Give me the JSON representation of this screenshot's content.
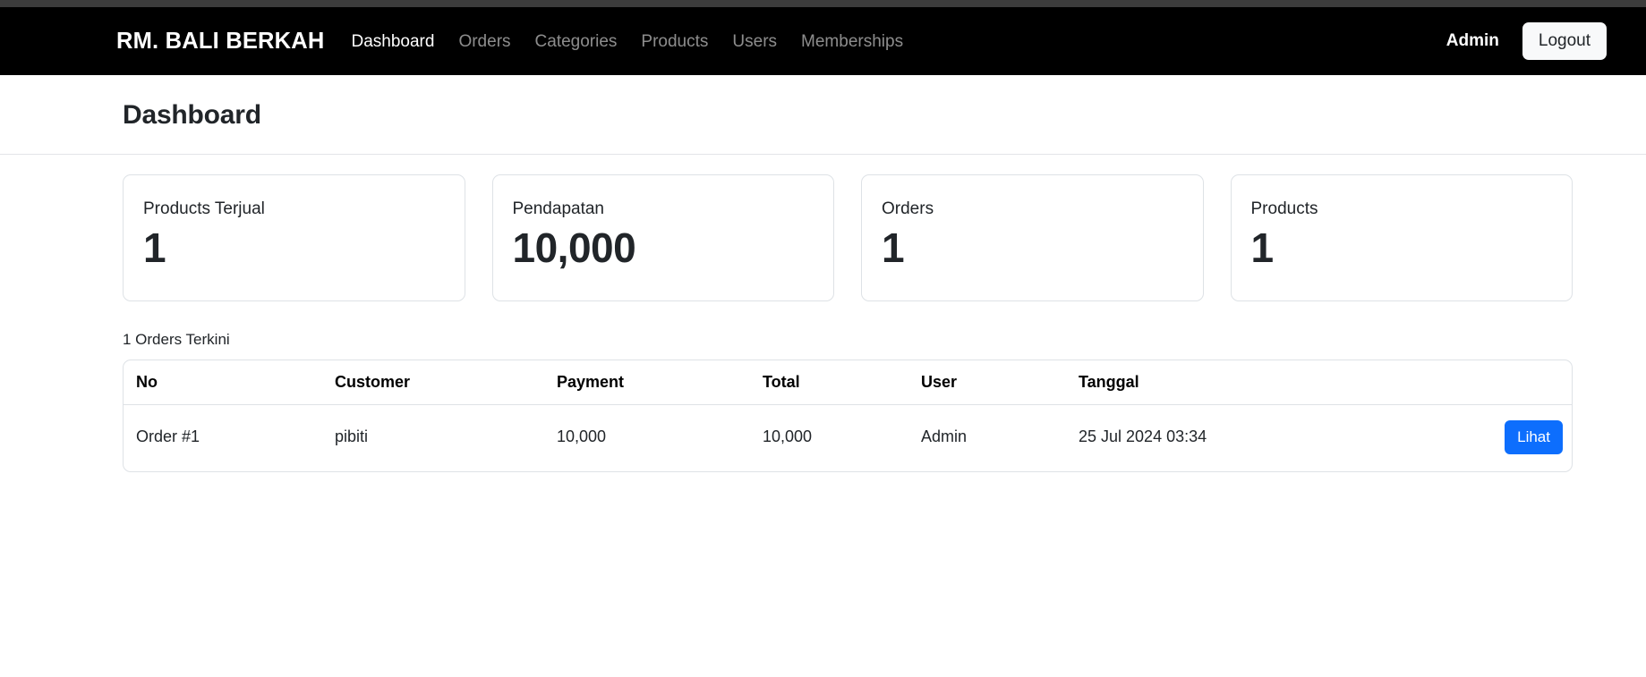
{
  "navbar": {
    "brand": "RM. BALI BERKAH",
    "links": [
      {
        "label": "Dashboard",
        "active": true
      },
      {
        "label": "Orders",
        "active": false
      },
      {
        "label": "Categories",
        "active": false
      },
      {
        "label": "Products",
        "active": false
      },
      {
        "label": "Users",
        "active": false
      },
      {
        "label": "Memberships",
        "active": false
      }
    ],
    "user_name": "Admin",
    "logout_label": "Logout",
    "background_color": "#000000",
    "active_link_color": "#ffffff",
    "inactive_link_color": "rgba(255,255,255,0.55)"
  },
  "page": {
    "title": "Dashboard",
    "background_color": "#ffffff"
  },
  "stats": [
    {
      "label": "Products Terjual",
      "value": "1"
    },
    {
      "label": "Pendapatan",
      "value": "10,000"
    },
    {
      "label": "Orders",
      "value": "1"
    },
    {
      "label": "Products",
      "value": "1"
    }
  ],
  "recent_orders": {
    "section_label": "1 Orders Terkini",
    "columns": [
      "No",
      "Customer",
      "Payment",
      "Total",
      "User",
      "Tanggal",
      ""
    ],
    "rows": [
      {
        "no": "Order #1",
        "customer": "pibiti",
        "payment": "10,000",
        "total": "10,000",
        "user": "Admin",
        "tanggal": "25 Jul 2024 03:34",
        "action_label": "Lihat"
      }
    ],
    "action_button_color": "#0d6efd",
    "border_color": "#dee2e6"
  }
}
